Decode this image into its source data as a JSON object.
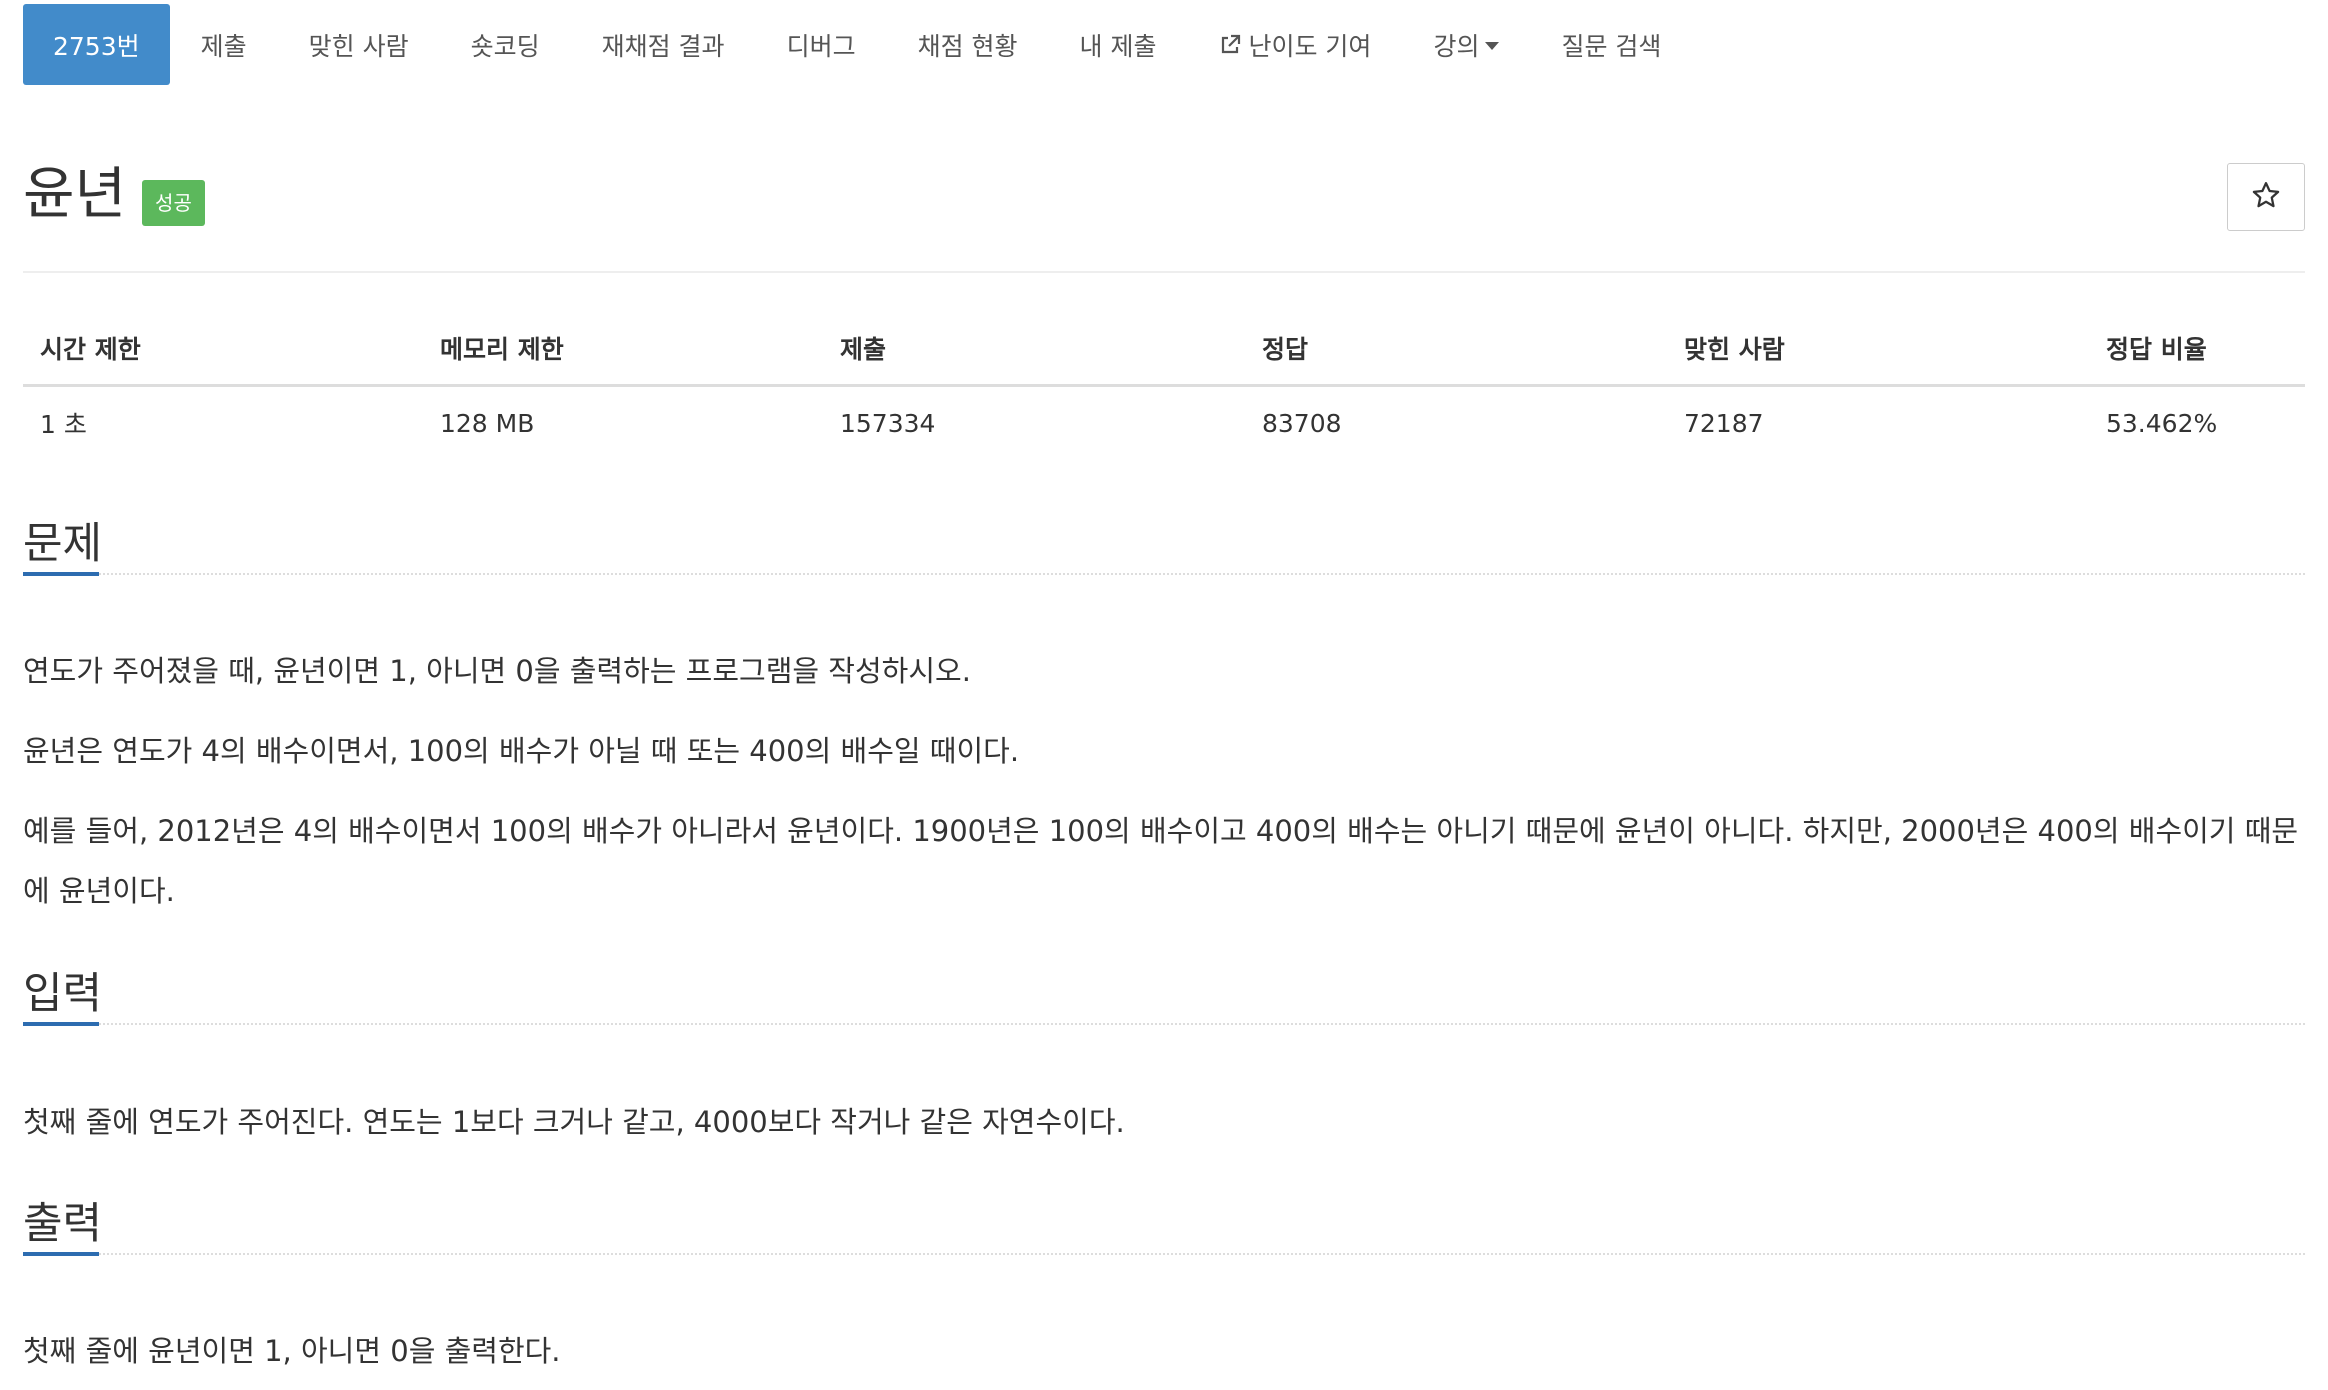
{
  "nav": {
    "items": [
      {
        "label": "2753번",
        "active": true
      },
      {
        "label": "제출"
      },
      {
        "label": "맞힌 사람"
      },
      {
        "label": "숏코딩"
      },
      {
        "label": "재채점 결과"
      },
      {
        "label": "디버그"
      },
      {
        "label": "채점 현황"
      },
      {
        "label": "내 제출"
      },
      {
        "label": "난이도 기여",
        "icon": "external-link-icon"
      },
      {
        "label": "강의",
        "icon": "caret-down-icon"
      },
      {
        "label": "질문 검색"
      }
    ]
  },
  "problem": {
    "title": "윤년",
    "status_badge": "성공",
    "star_icon": "star-icon"
  },
  "info_table": {
    "headers": [
      "시간 제한",
      "메모리 제한",
      "제출",
      "정답",
      "맞힌 사람",
      "정답 비율"
    ],
    "values": [
      "1 초",
      "128 MB",
      "157334",
      "83708",
      "72187",
      "53.462%"
    ]
  },
  "sections": {
    "problem": {
      "heading": "문제",
      "paragraphs": [
        "연도가 주어졌을 때, 윤년이면 1, 아니면 0을 출력하는 프로그램을 작성하시오.",
        "윤년은 연도가 4의 배수이면서, 100의 배수가 아닐 때 또는 400의 배수일 때이다.",
        "예를 들어, 2012년은 4의 배수이면서 100의 배수가 아니라서 윤년이다. 1900년은 100의 배수이고 400의 배수는 아니기 때문에 윤년이 아니다. 하지만, 2000년은 400의 배수이기 때문에 윤년이다."
      ]
    },
    "input": {
      "heading": "입력",
      "paragraphs": [
        "첫째 줄에 연도가 주어진다. 연도는 1보다 크거나 같고, 4000보다 작거나 같은 자연수이다."
      ]
    },
    "output": {
      "heading": "출력",
      "paragraphs": [
        "첫째 줄에 윤년이면 1, 아니면 0을 출력한다."
      ]
    }
  },
  "colors": {
    "active_tab": "#428bca",
    "success_badge": "#5cb85c",
    "section_underline": "#2d6cb0"
  }
}
